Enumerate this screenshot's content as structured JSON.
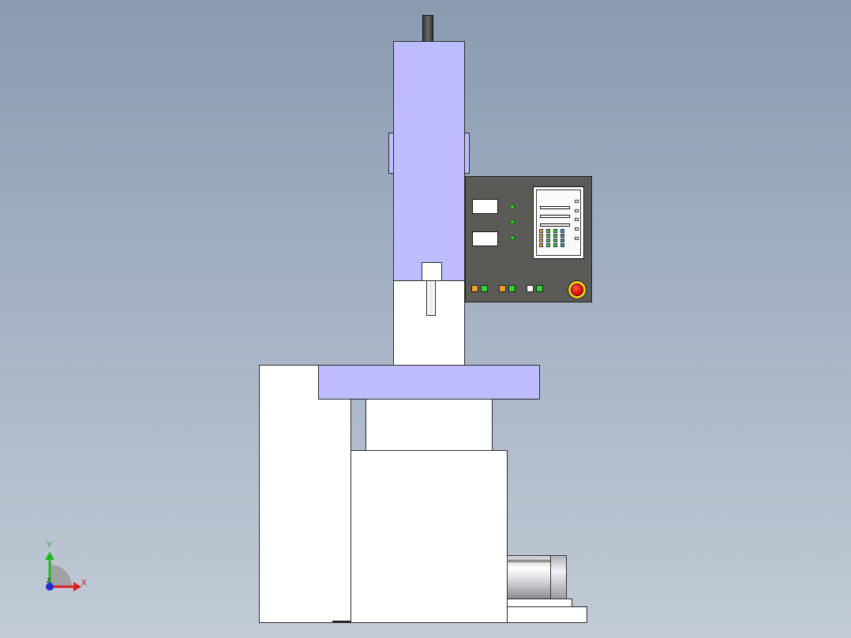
{
  "viewport": {
    "background": "gradient-gray-blue",
    "model": "press-machine-front-view"
  },
  "triad": {
    "y_label": "Y",
    "x_label": "X",
    "z_label": "Z"
  },
  "colors": {
    "housing": "#bcbcff",
    "body": "#ffffff",
    "control_panel": "#5a5a56",
    "led_green": "#2fd52f",
    "button_orange": "#f0a030",
    "button_green": "#2fd52f",
    "estop_red": "#e81010",
    "estop_ring": "#f0d020"
  },
  "control_panel": {
    "button_colors": [
      "orange",
      "green",
      "orange",
      "green",
      "white",
      "green"
    ],
    "keypad_rows": 4,
    "keypad_cols": 4
  }
}
